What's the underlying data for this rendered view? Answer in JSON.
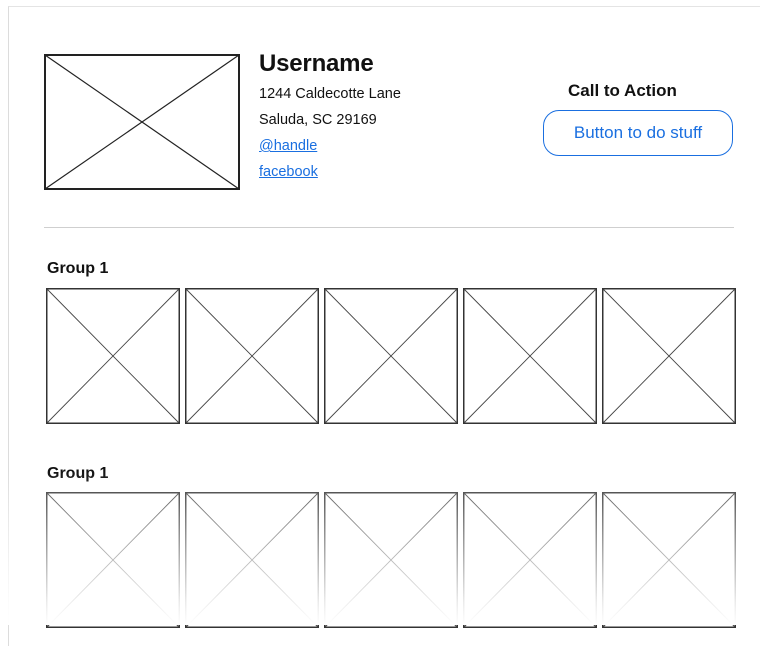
{
  "profile": {
    "username": "Username",
    "address_line1": "1244 Caldecotte Lane",
    "address_line2": "Saluda, SC 29169",
    "handle_link": "@handle",
    "facebook_link": "facebook"
  },
  "cta": {
    "title": "Call to Action",
    "button_label": "Button to do stuff"
  },
  "groups": [
    {
      "title": "Group 1",
      "tiles": 5
    },
    {
      "title": "Group 1",
      "tiles": 5
    }
  ],
  "colors": {
    "link": "#1a6fe0",
    "placeholder_stroke": "#222222",
    "divider": "#cfcfcf"
  },
  "icons": {
    "image_placeholder": "image-placeholder-icon"
  }
}
